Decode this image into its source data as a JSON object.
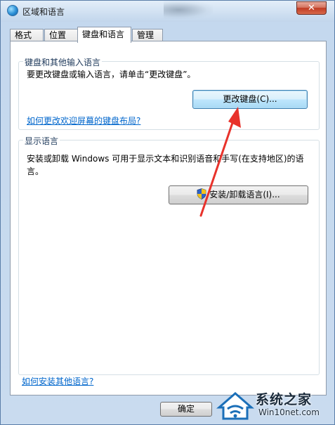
{
  "window": {
    "title": "区域和语言",
    "close_glyph": "✕"
  },
  "tabs": [
    {
      "label": "格式",
      "active": false
    },
    {
      "label": "位置",
      "active": false
    },
    {
      "label": "键盘和语言",
      "active": true
    },
    {
      "label": "管理",
      "active": false
    }
  ],
  "keyboard_group": {
    "legend": "键盘和其他输入语言",
    "description": "要更改键盘或输入语言，请单击“更改键盘”。",
    "change_keyboard_button": "更改键盘(C)...",
    "welcome_layout_link": "如何更改欢迎屏幕的键盘布局?"
  },
  "display_group": {
    "legend": "显示语言",
    "description_line1": "安装或卸载 Windows 可用于显示文本和识别语音和手写(在支持地区)的语",
    "description_line2": "言。",
    "install_button": "安装/卸载语言(I)..."
  },
  "help_link": "如何安装其他语言?",
  "footer": {
    "ok_button": "确定"
  },
  "watermark": {
    "brand_name": "系统之家",
    "site": "Win10net.com"
  },
  "colors": {
    "link": "#0066cc",
    "annotation_arrow": "#e8322b",
    "close_button": "#c7472f"
  }
}
